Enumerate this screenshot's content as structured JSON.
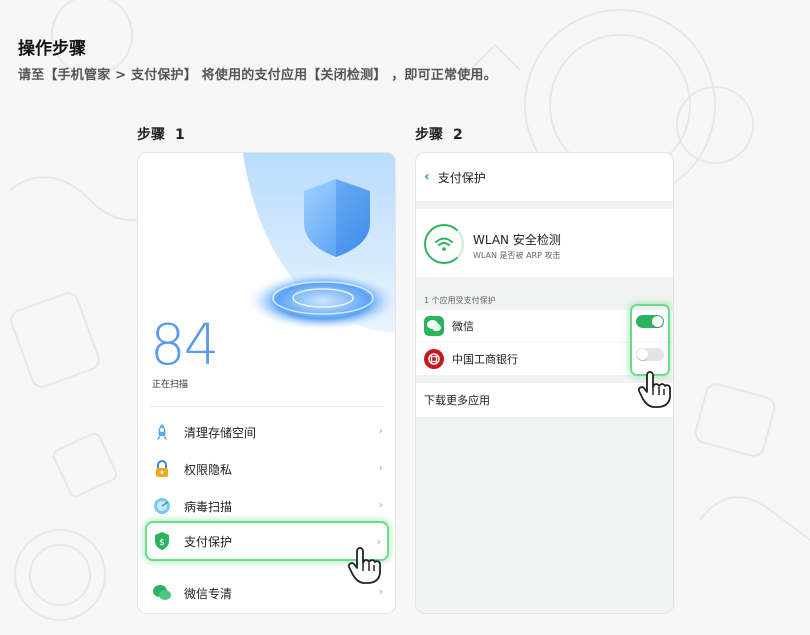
{
  "page": {
    "title": "操作步骤",
    "description": "请至【手机管家 > 支付保护】 将使用的支付应用【关闭检测】 ，即可正常使用。"
  },
  "steps": [
    {
      "label": "步骤",
      "num": "1"
    },
    {
      "label": "步骤",
      "num": "2"
    }
  ],
  "phone1": {
    "score": "84",
    "score_label": "正在扫描",
    "menu": [
      {
        "label": "清理存储空间",
        "icon": "rocket-icon",
        "chevron": "›"
      },
      {
        "label": "权限隐私",
        "icon": "lock-icon",
        "chevron": "›"
      },
      {
        "label": "病毒扫描",
        "icon": "scan-icon",
        "chevron": "›"
      },
      {
        "label": "支付保护",
        "icon": "shield-dollar-icon",
        "chevron": "›"
      },
      {
        "label": "微信专清",
        "icon": "wechat-icon",
        "chevron": "›"
      }
    ]
  },
  "phone2": {
    "back_icon": "‹",
    "header_title": "支付保护",
    "wlan_title": "WLAN 安全检测",
    "wlan_subtitle": "WLAN 是否被 ARP 攻击",
    "section_label": "1 个应用受支付保护",
    "apps": [
      {
        "name": "微信",
        "icon": "wechat-icon",
        "enabled": true
      },
      {
        "name": "中国工商银行",
        "icon": "icbc-icon",
        "enabled": false
      }
    ],
    "more_label": "下载更多应用"
  },
  "colors": {
    "accent_green": "#2db35d",
    "highlight_green": "#6cdb8a",
    "score_blue": "#5b9af0"
  }
}
